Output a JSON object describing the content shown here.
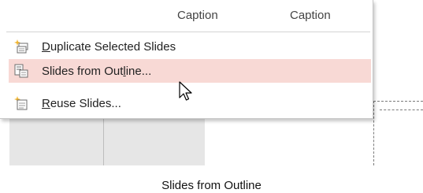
{
  "gallery": {
    "caption_left": "Caption",
    "caption_right": "Caption"
  },
  "menu": {
    "items": [
      {
        "prefix": "",
        "accel": "D",
        "rest": "uplicate Selected Slides",
        "icon": "duplicate-slides-icon",
        "highlighted": false
      },
      {
        "prefix": "Slides from Out",
        "accel": "l",
        "rest": "ine...",
        "icon": "slides-from-outline-icon",
        "highlighted": true
      },
      {
        "prefix": "",
        "accel": "R",
        "rest": "euse Slides...",
        "icon": "reuse-slides-icon",
        "highlighted": false
      }
    ]
  },
  "highlight_color": "#f8d9d5",
  "figure_caption": "Slides from Outline"
}
